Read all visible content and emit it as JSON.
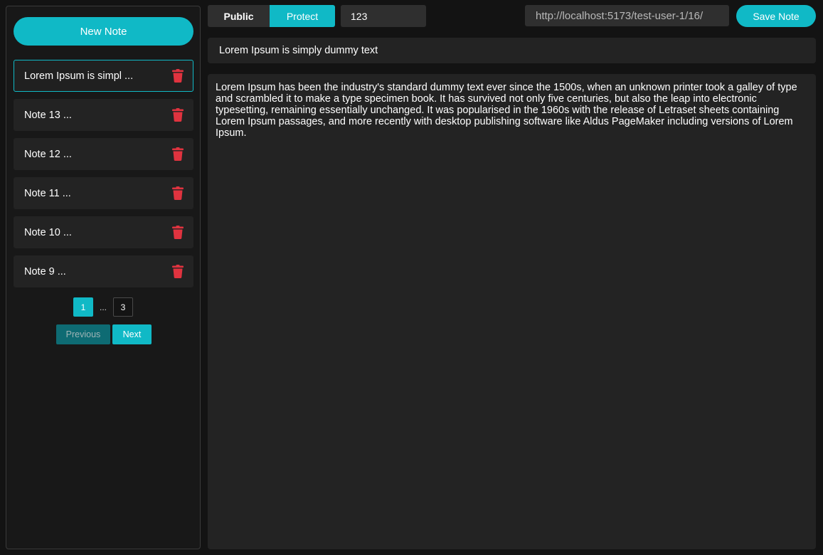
{
  "sidebar": {
    "new_note_label": "New Note",
    "notes": [
      {
        "label": "Lorem Ipsum is simpl ...",
        "selected": true
      },
      {
        "label": "Note 13 ...",
        "selected": false
      },
      {
        "label": "Note 12 ...",
        "selected": false
      },
      {
        "label": "Note 11 ...",
        "selected": false
      },
      {
        "label": "Note 10 ...",
        "selected": false
      },
      {
        "label": "Note 9 ...",
        "selected": false
      }
    ],
    "pagination": {
      "current": "1",
      "ellipsis": "...",
      "last": "3",
      "previous_label": "Previous",
      "next_label": "Next"
    }
  },
  "toolbar": {
    "public_label": "Public",
    "protect_label": "Protect",
    "password_value": "123",
    "share_url": "http://localhost:5173/test-user-1/16/",
    "save_label": "Save Note"
  },
  "editor": {
    "title": "Lorem Ipsum is simply dummy text",
    "body": "Lorem Ipsum has been the industry's standard dummy text ever since the 1500s, when an unknown printer took a galley of type and scrambled it to make a type specimen book. It has survived not only five centuries, but also the leap into electronic typesetting, remaining essentially unchanged. It was popularised in the 1960s with the release of Letraset sheets containing Lorem Ipsum passages, and more recently with desktop publishing software like Aldus PageMaker including versions of Lorem Ipsum."
  },
  "colors": {
    "accent": "#10b9c6",
    "trash": "#e0333f"
  },
  "icons": {
    "delete": "trash-icon"
  }
}
